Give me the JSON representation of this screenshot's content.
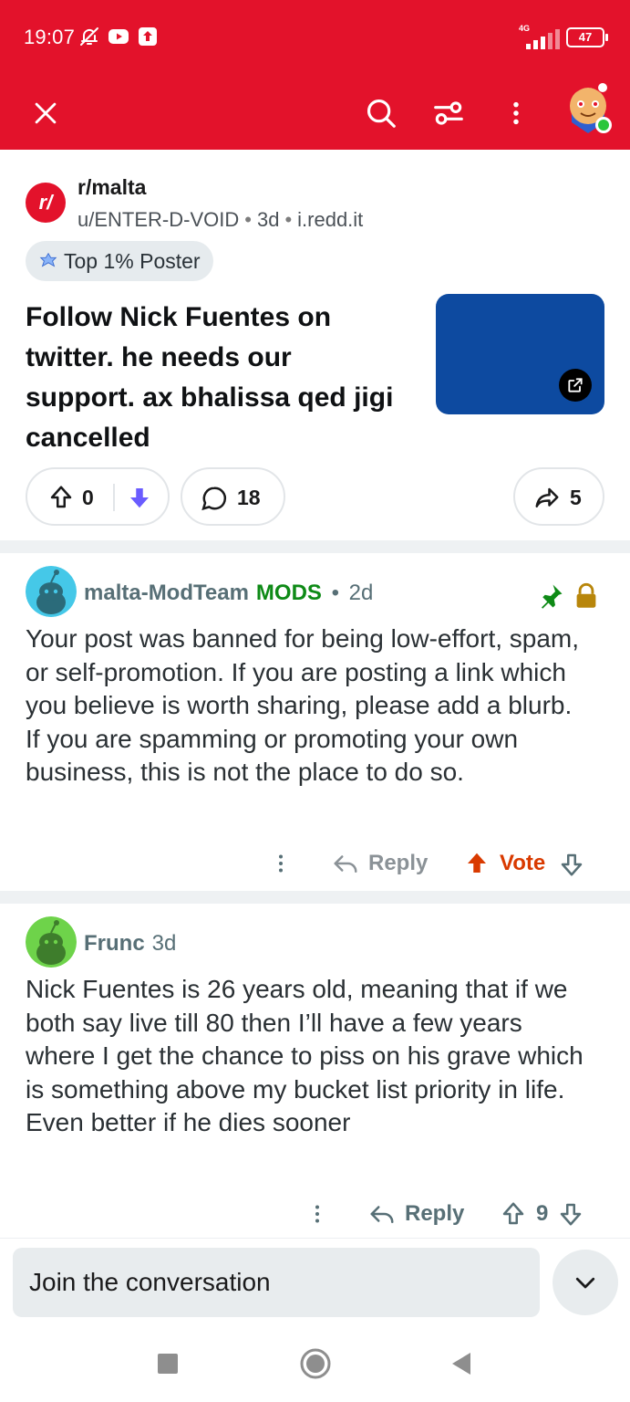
{
  "status_bar": {
    "time": "19:07",
    "network": "4G",
    "battery": "47"
  },
  "app_bar": {
    "icons": [
      "close-icon",
      "search-icon",
      "filter-icon",
      "more-vertical-icon",
      "user-avatar"
    ]
  },
  "post": {
    "subreddit": "r/malta",
    "author": "u/ENTER-D-VOID",
    "age": "3d",
    "domain": "i.redd.it",
    "flair": "Top 1% Poster",
    "title": "Follow Nick Fuentes on twitter. he needs our support. ax bhalissa qed jigi cancelled",
    "thumbnail_color": "#0d4aa0",
    "vote_count": "0",
    "comment_count": "18",
    "share_count": "5"
  },
  "comments": [
    {
      "user": "malta-ModTeam",
      "badge": "MODS",
      "age": "2d",
      "text": "Your post was banned for being low-effort, spam, or self-promotion. If you are posting a link which you believe is worth sharing, please add a blurb. If you are spamming or promoting your own business, this is not the place to do so.",
      "reply_label": "Reply",
      "vote_label": "Vote"
    },
    {
      "user": "Frunc",
      "age": "3d",
      "text": "Nick Fuentes is 26 years old, meaning that if we both say live till 80 then I’ll have a few years where I get the chance to piss on his grave which is something above my bucket list priority in life. Even better if he dies sooner",
      "reply_label": "Reply",
      "score": "9"
    }
  ],
  "composer": {
    "placeholder": "Join the conversation"
  },
  "colors": {
    "brand_red": "#e3122b",
    "mod_green": "#0e8a16",
    "vote_orange": "#d93a00",
    "downvote_purple": "#6a5cff"
  }
}
